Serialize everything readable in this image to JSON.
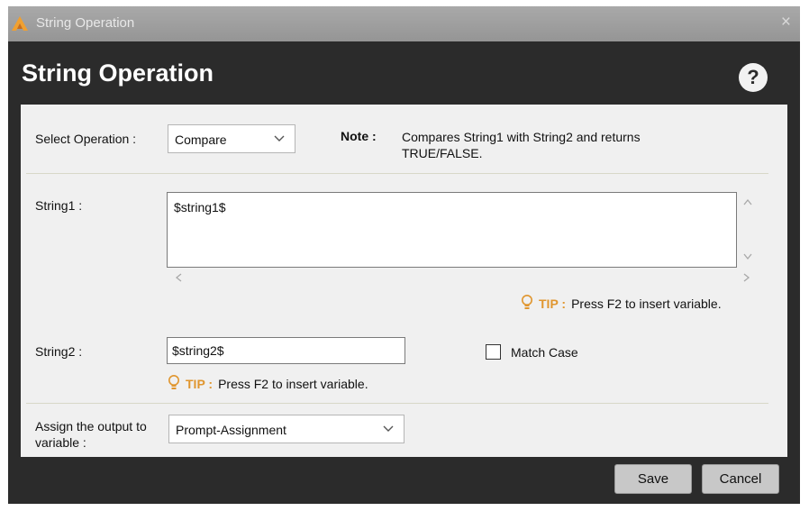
{
  "titlebar": {
    "title": "String Operation",
    "close_glyph": "×"
  },
  "header": {
    "title": "String Operation",
    "help_glyph": "?"
  },
  "operation": {
    "label": "Select Operation :",
    "selected": "Compare"
  },
  "note": {
    "label": "Note :",
    "text": "Compares String1 with String2 and returns TRUE/FALSE."
  },
  "string1": {
    "label": "String1 :",
    "value": "$string1$"
  },
  "string2": {
    "label": "String2 :",
    "value": "$string2$"
  },
  "tip": {
    "word": "TIP :",
    "text": "Press F2 to insert variable."
  },
  "match_case": {
    "label": "Match Case",
    "checked": false
  },
  "output": {
    "label": "Assign the output to variable :",
    "selected": "Prompt-Assignment"
  },
  "buttons": {
    "save": "Save",
    "cancel": "Cancel"
  },
  "icons": {
    "app": "app-logo-icon",
    "close": "close-icon",
    "help": "help-icon",
    "dropdown": "chevron-down-icon",
    "tip": "lightbulb-icon",
    "scroll_up": "scroll-up-icon",
    "scroll_down": "scroll-down-icon",
    "scroll_left": "scroll-left-icon",
    "scroll_right": "scroll-right-icon"
  },
  "colors": {
    "dark_bg": "#2b2b2b",
    "panel_bg": "#f0f0f0",
    "tip_accent": "#e0962f",
    "titlebar": "#9e9e9e"
  }
}
